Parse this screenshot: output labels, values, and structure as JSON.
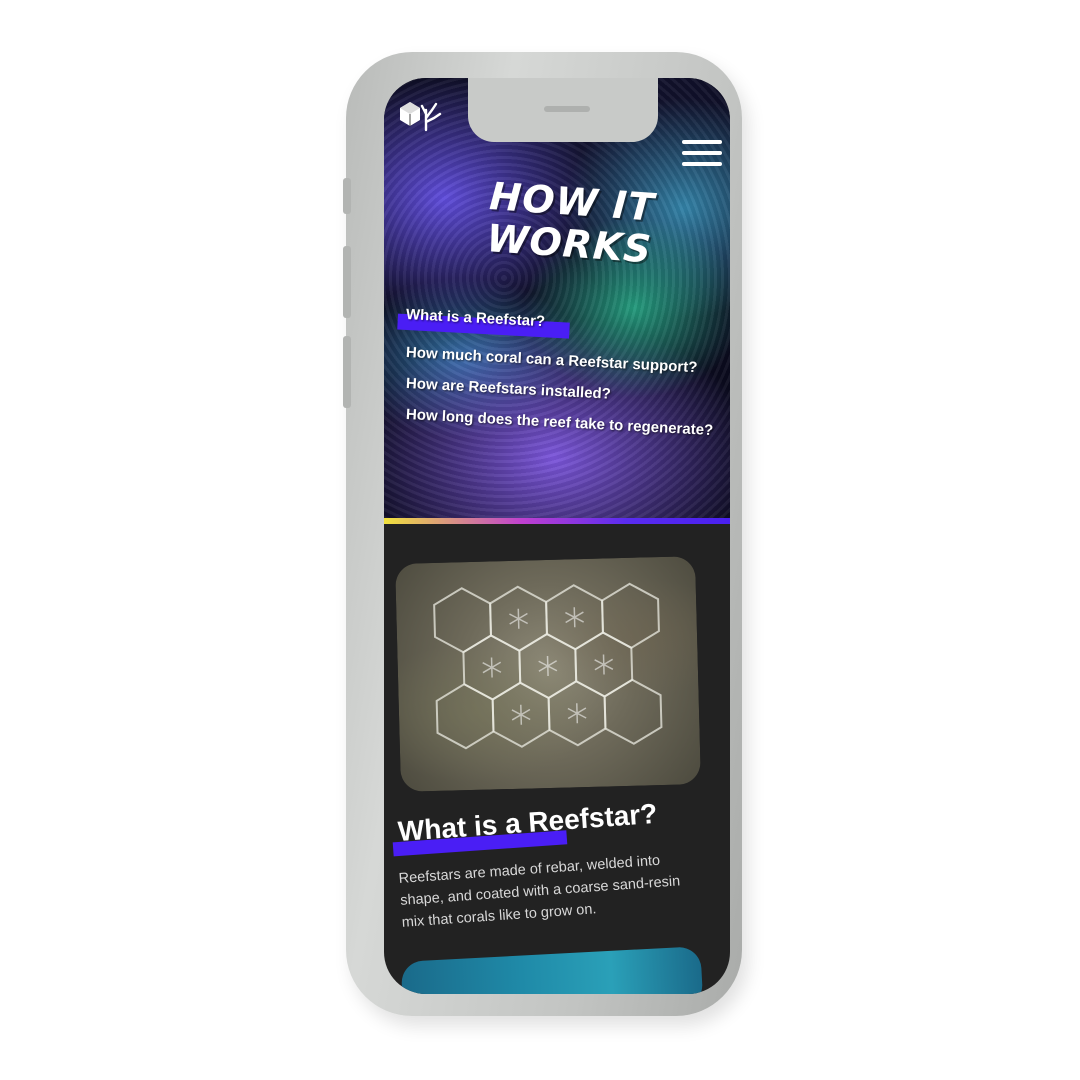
{
  "hero": {
    "title_line1": "HOW IT",
    "title_line2": "WORKS"
  },
  "faq": [
    {
      "label": "What is a Reefstar?",
      "active": true
    },
    {
      "label": "How much coral can a Reefstar support?",
      "active": false
    },
    {
      "label": "How are Reefstars installed?",
      "active": false
    },
    {
      "label": "How long does the reef take to regenerate?",
      "active": false
    }
  ],
  "section": {
    "title": "What is a Reefstar?",
    "body": "Reefstars are made of rebar, welded into shape, and coated with a coarse sand-resin mix that corals like to grow on."
  },
  "icons": {
    "logo": "reefstar-logo-icon",
    "menu": "hamburger-menu-icon"
  },
  "colors": {
    "accent": "#4a1ef5",
    "background": "#222222",
    "stripe_start": "#f0e13c"
  }
}
